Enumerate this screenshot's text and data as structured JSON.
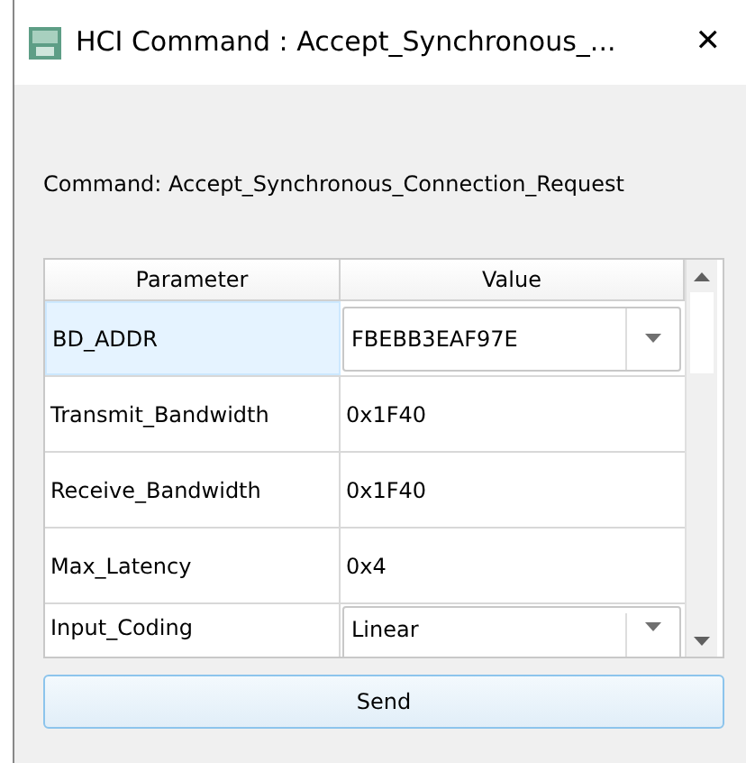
{
  "window": {
    "title": "HCI Command : Accept_Synchronous_...",
    "close": "✕"
  },
  "command_label": "Command: Accept_Synchronous_Connection_Request",
  "table": {
    "columns": [
      "Parameter",
      "Value"
    ],
    "rows": [
      {
        "parameter": "BD_ADDR",
        "value": "FBEBB3EAF97E",
        "kind": "combo",
        "selected": true
      },
      {
        "parameter": "Transmit_Bandwidth",
        "value": "0x1F40",
        "kind": "text",
        "selected": false
      },
      {
        "parameter": "Receive_Bandwidth",
        "value": "0x1F40",
        "kind": "text",
        "selected": false
      },
      {
        "parameter": "Max_Latency",
        "value": "0x4",
        "kind": "text",
        "selected": false
      },
      {
        "parameter": "Input_Coding",
        "value": "Linear",
        "kind": "combo",
        "selected": false
      }
    ]
  },
  "send_button": "Send"
}
